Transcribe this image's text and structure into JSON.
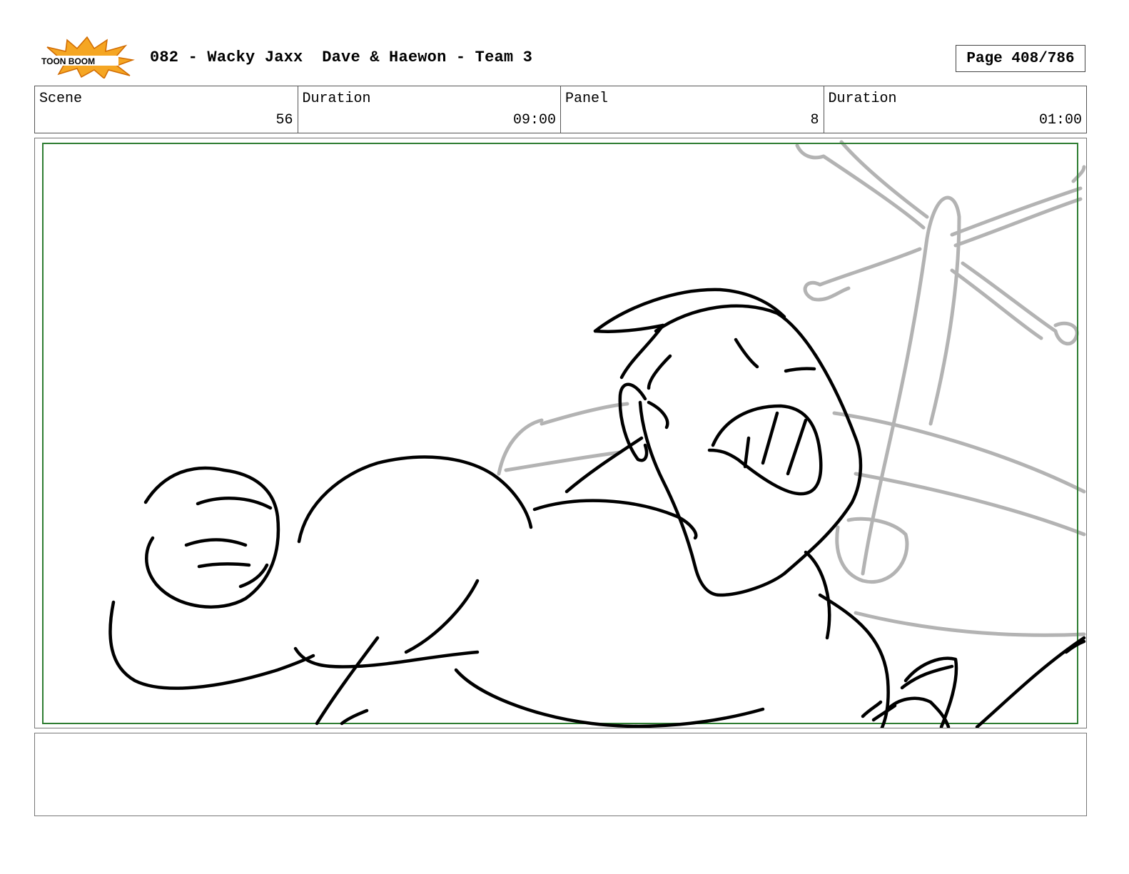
{
  "header": {
    "logo_text": "TOON BOOM",
    "title": "082 - Wacky Jaxx  Dave & Haewon - Team 3",
    "page_label": "Page 408/786"
  },
  "info": {
    "scene_label": "Scene",
    "scene_value": "56",
    "scene_duration_label": "Duration",
    "scene_duration_value": "09:00",
    "panel_label": "Panel",
    "panel_value": "8",
    "panel_duration_label": "Duration",
    "panel_duration_value": "01:00"
  },
  "notes": {
    "text": ""
  },
  "colors": {
    "safe_frame": "#2e7d32",
    "sketch_ink": "#000000",
    "background_sketch": "#b3b3b3",
    "logo_orange": "#f5a623"
  }
}
